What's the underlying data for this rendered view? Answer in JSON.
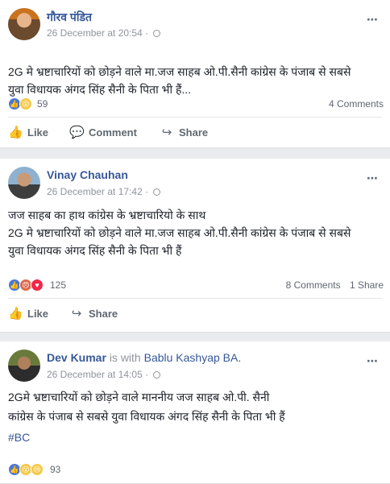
{
  "posts": [
    {
      "author": "गौरव पंडित",
      "timestamp": "26 December at 20:54",
      "separator": "·",
      "text_lines": [
        "2G मे भ्रष्टाचारियों को छोड़ने वाले मा.जज साहब ओ.पी.सैनी कांग्रेस के पंजाब से सबसे",
        "युवा विधायक अंगद सिंह सैनी के पिता भी हैं..."
      ],
      "reaction_count": "59",
      "comments": "4 Comments",
      "actions": [
        "Like",
        "Comment",
        "Share"
      ]
    },
    {
      "author": "Vinay Chauhan",
      "timestamp": "26 December at 17:42",
      "separator": "·",
      "text_lines": [
        "जज साहब का हाथ कांग्रेस के भ्रष्टाचारियो के साथ",
        "2G मे भ्रष्टाचारियों को छोड़ने वाले मा.जज साहब ओ.पी.सैनी कांग्रेस के पंजाब से सबसे",
        "युवा विधायक अंगद सिंह सैनी के पिता भी हैं"
      ],
      "reaction_count": "125",
      "comments": "8 Comments",
      "shares": "1 Share",
      "actions": [
        "Like",
        "Share"
      ]
    },
    {
      "author": "Dev Kumar",
      "with_text": "is with",
      "with_name": "Bablu Kashyap BA.",
      "timestamp": "26 December at 14:05",
      "separator": "·",
      "text_lines": [
        "2Gमे भ्रष्टाचारियों को छोड़ने वाले माननीय जज साहब ओ.पी. सैनी",
        "कांग्रेस के पंजाब से सबसे युवा विधायक अंगद सिंह सैनी के पिता भी हैं"
      ],
      "hashtag": "#BC",
      "reaction_count": "93"
    }
  ],
  "icons": {
    "more": "⋯",
    "like": "👍",
    "comment": "💬",
    "share": "↪",
    "reaction_like": "👍",
    "reaction_wow": "😮",
    "reaction_angry": "😠",
    "reaction_love": "♥",
    "reaction_sad": "😢"
  },
  "colors": {
    "link": "#365899",
    "meta": "#90949c",
    "background": "#e9ebee"
  }
}
